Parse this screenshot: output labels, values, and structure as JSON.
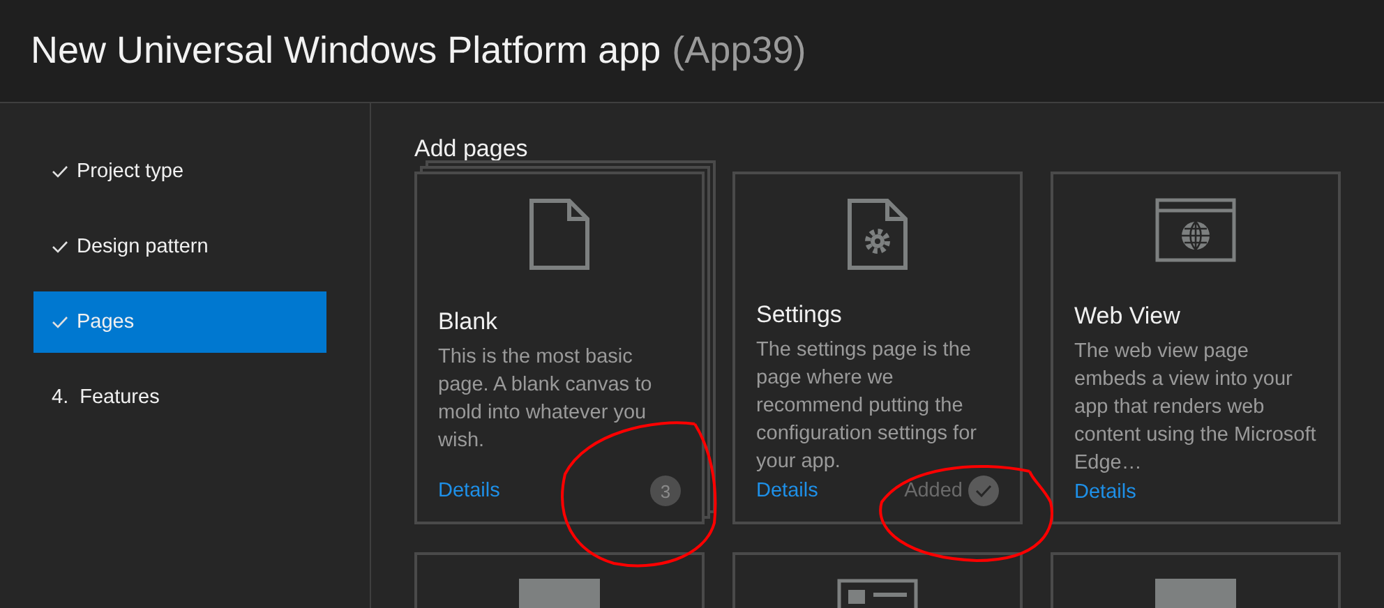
{
  "window": {
    "title": "New Universal Windows Platform app",
    "project": "(App39)"
  },
  "steps": [
    {
      "label": "Project type",
      "done": true,
      "selected": false
    },
    {
      "label": "Design pattern",
      "done": true,
      "selected": false
    },
    {
      "label": "Pages",
      "done": true,
      "selected": true
    },
    {
      "label": "Features",
      "number": "4.",
      "done": false,
      "selected": false
    }
  ],
  "section_title": "Add pages",
  "cards": [
    {
      "kind": "blank",
      "title": "Blank",
      "description": "This is the most basic page. A blank canvas to mold into whatever you wish.",
      "link": "Details",
      "count": "3",
      "added": false
    },
    {
      "kind": "settings",
      "title": "Settings",
      "description": "The settings page is the page where we recommend putting the configuration settings for your app.",
      "link": "Details",
      "status": "Added",
      "added": true
    },
    {
      "kind": "webview",
      "title": "Web View",
      "description": "The web view page embeds a view into your app that renders web content using the Microsoft Edge…",
      "link": "Details",
      "added": false
    },
    {
      "kind": "block"
    },
    {
      "kind": "form"
    },
    {
      "kind": "block"
    }
  ]
}
